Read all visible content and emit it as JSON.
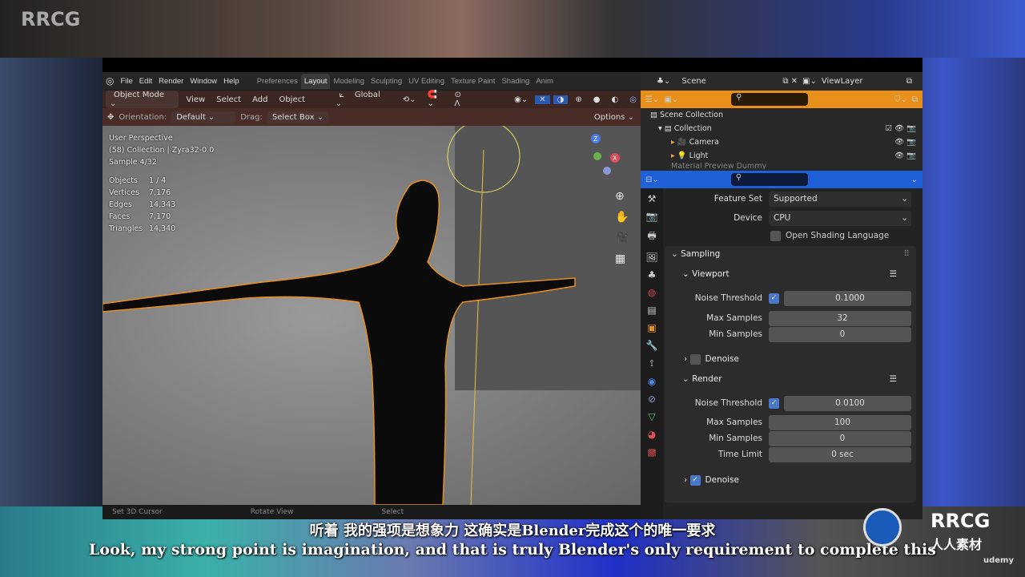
{
  "watermark": "RRCG",
  "menu": {
    "items": [
      "File",
      "Edit",
      "Render",
      "Window",
      "Help"
    ],
    "workspaces": [
      "Preferences",
      "Layout",
      "Modeling",
      "Sculpting",
      "UV Editing",
      "Texture Paint",
      "Shading",
      "Anim"
    ],
    "active_workspace": "Layout"
  },
  "scene": {
    "label": "Scene",
    "view_layer": "ViewLayer"
  },
  "viewport_header": {
    "mode": "Object Mode",
    "items": [
      "View",
      "Select",
      "Add",
      "Object"
    ],
    "transform": "Global"
  },
  "tool_header": {
    "orientation_label": "Orientation:",
    "orientation": "Default",
    "drag_label": "Drag:",
    "drag": "Select Box",
    "options": "Options"
  },
  "overlay": {
    "perspective": "User Perspective",
    "collection": "(58) Collection | Zyra32-0.0",
    "sample": "Sample 4/32",
    "stats": [
      {
        "k": "Objects",
        "v": "1 / 4"
      },
      {
        "k": "Vertices",
        "v": "7,176"
      },
      {
        "k": "Edges",
        "v": "14,343"
      },
      {
        "k": "Faces",
        "v": "7,170"
      },
      {
        "k": "Triangles",
        "v": "14,340"
      }
    ]
  },
  "statusbar": [
    "Set 3D Cursor",
    "Rotate View",
    "Select"
  ],
  "outliner": {
    "scene_collection": "Scene Collection",
    "collection": "Collection",
    "items": [
      "Camera",
      "Light",
      "Material Preview Dummy"
    ]
  },
  "properties": {
    "feature_set_label": "Feature Set",
    "feature_set": "Supported",
    "device_label": "Device",
    "device": "CPU",
    "osl": "Open Shading Language",
    "sampling": "Sampling",
    "viewport": {
      "title": "Viewport",
      "noise_label": "Noise Threshold",
      "noise": "0.1000",
      "noise_enabled": true,
      "max_label": "Max Samples",
      "max": "32",
      "min_label": "Min Samples",
      "min": "0",
      "denoise": "Denoise",
      "denoise_enabled": false
    },
    "render": {
      "title": "Render",
      "noise_label": "Noise Threshold",
      "noise": "0.0100",
      "noise_enabled": true,
      "max_label": "Max Samples",
      "max": "100",
      "min_label": "Min Samples",
      "min": "0",
      "time_label": "Time Limit",
      "time": "0 sec",
      "denoise": "Denoise",
      "denoise_enabled": true
    }
  },
  "subtitles": {
    "zh": "听着 我的强项是想象力 这确实是Blender完成这个的唯一要求",
    "en": "Look, my strong point is imagination, and that is truly Blender's only requirement to complete this"
  },
  "brand": {
    "logo": "RRCG",
    "logo_sub": "人人素材",
    "udemy": "udemy"
  },
  "colors": {
    "outliner_header": "#e8901a",
    "properties_header": "#1f5fd8",
    "selection_outline": "#e8901a"
  }
}
